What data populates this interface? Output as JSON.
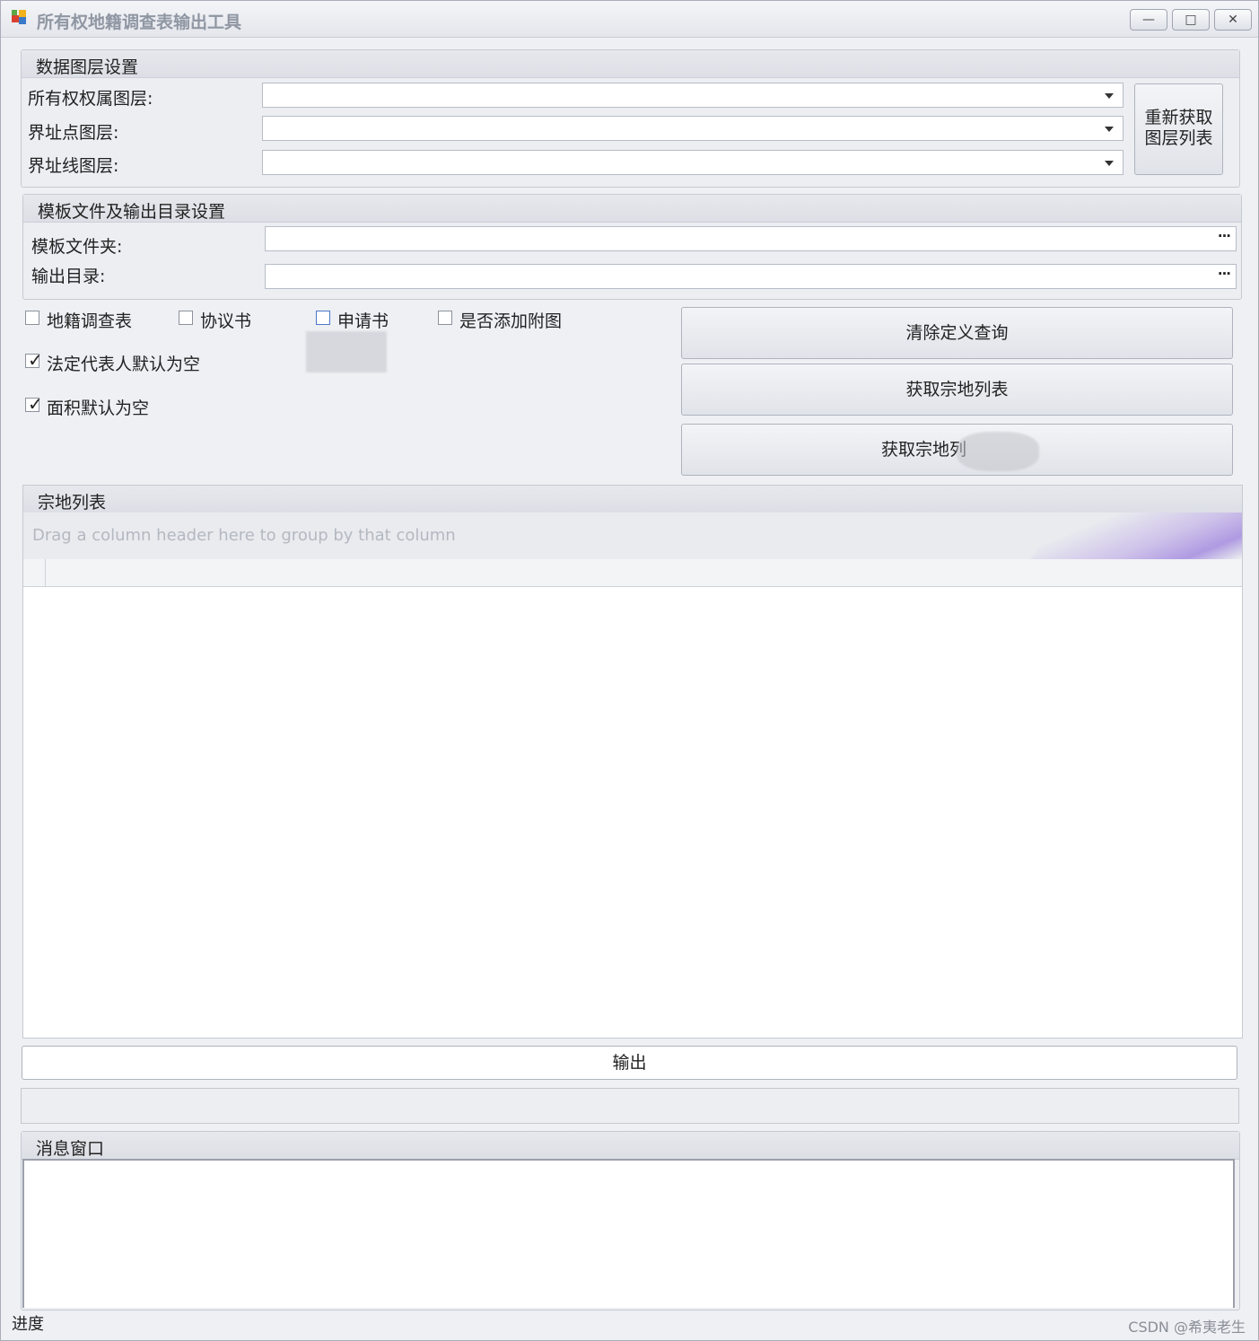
{
  "window": {
    "title": "所有权地籍调查表输出工具",
    "min_symbol": "—",
    "max_symbol": "□",
    "close_symbol": "✕"
  },
  "layer_settings": {
    "header": "数据图层设置",
    "ownership_label": "所有权权属图层:",
    "ownership_value": "",
    "boundary_point_label": "界址点图层:",
    "boundary_point_value": "",
    "boundary_line_label": "界址线图层:",
    "boundary_line_value": "",
    "refresh_button": "重新获取 图层列表"
  },
  "template_settings": {
    "header": "模板文件及输出目录设置",
    "template_label": "模板文件夹:",
    "template_value": "",
    "output_label": "输出目录:",
    "output_value": "",
    "browse_symbol": "···"
  },
  "options": {
    "cadastral_survey": {
      "label": "地籍调查表",
      "checked": false
    },
    "agreement": {
      "label": "协议书",
      "checked": false
    },
    "application": {
      "label": "申请书",
      "checked": false
    },
    "add_attachment": {
      "label": "是否添加附图",
      "checked": false
    },
    "legal_rep_empty": {
      "label": "法定代表人默认为空",
      "checked": true
    },
    "area_empty": {
      "label": "面积默认为空",
      "checked": true
    }
  },
  "actions": {
    "clear_query": "清除定义查询",
    "get_parcel_list": "获取宗地列表",
    "get_parcel_list_partial": "获取宗地列"
  },
  "parcel_list": {
    "header": "宗地列表",
    "group_hint": "Drag a column header here to group by that column"
  },
  "export_button": "输出",
  "messages": {
    "header": "消息窗口",
    "content": ""
  },
  "status_label": "进度",
  "watermark": "CSDN @希夷老生"
}
